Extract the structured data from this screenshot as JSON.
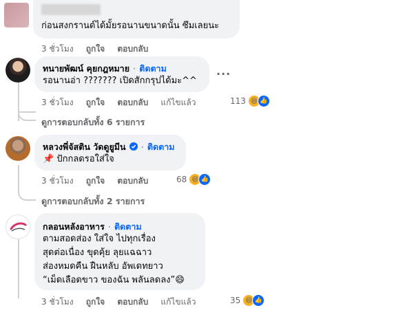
{
  "comments": [
    {
      "name": "",
      "text": "ก่อนสงกรานต์ได้มั้ยรอนานขนาดนั้น ซึมเลยนะ",
      "time": "3 ชั่วโมง",
      "like": "ถูกใจ",
      "reply": "ตอบกลับ"
    },
    {
      "name": "ทนายพัฒน์ คุยกฎหมาย",
      "follow": "ติดตาม",
      "text": "รอนานอ่า ??????? เปิดสักกรุปได้มะ^^",
      "time": "3 ชั่วโมง",
      "like": "ถูกใจ",
      "reply": "ตอบกลับ",
      "edited": "แก้ไขแล้ว",
      "reactions": "113",
      "view_replies": "ดูการตอบกลับทั้ง 6 รายการ"
    },
    {
      "name": "หลวงพี่จัสติน วัดดูยูมีน",
      "follow": "ติดตาม",
      "text": "📌 ปักกลดรอใส่ใจ",
      "time": "3 ชั่วโมง",
      "like": "ถูกใจ",
      "reply": "ตอบกลับ",
      "reactions": "68",
      "view_replies": "ดูการตอบกลับทั้ง 2 รายการ"
    },
    {
      "name": "กลอนหลังอาหาร",
      "follow": "ติดตาม",
      "lines": [
        "ตามสอดส่อง ใส่ใจ ไปทุกเรื่อง",
        "สุดต่อเนื่อง ขุดคุ้ย ลุยแฉฉาว",
        "ส่องหมดคืน ฝืนหลับ อัพเดทยาว",
        "“เม็ดเลือดขาว ของฉัน พลันลดลง”😄"
      ],
      "time": "3 ชั่วโมง",
      "like": "ถูกใจ",
      "reply": "ตอบกลับ",
      "edited": "แก้ไขแล้ว",
      "reactions": "35"
    }
  ],
  "icons": {
    "haha": "😆",
    "like": "👍",
    "more": "···"
  },
  "colors": {
    "bubble": "#f0f2f5",
    "follow": "#0866ff",
    "meta": "#65676b"
  }
}
